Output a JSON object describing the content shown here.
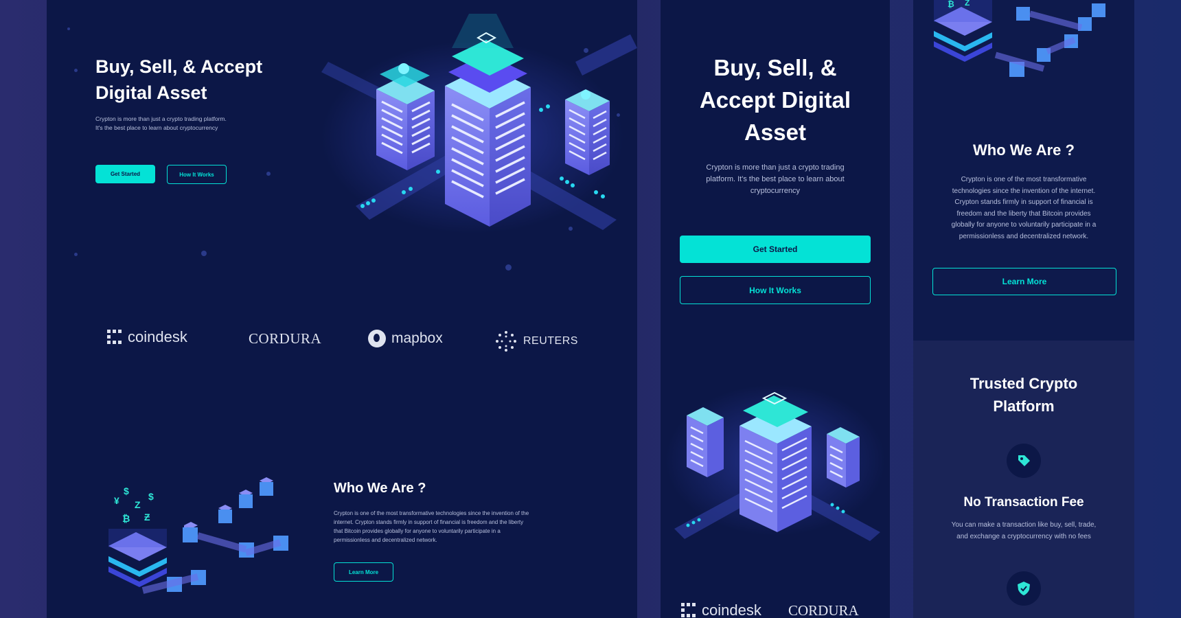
{
  "colors": {
    "background": "#0c1747",
    "accent": "#04e2d6",
    "text": "#ffffff",
    "muted": "#b8c0dd"
  },
  "desktop": {
    "hero": {
      "title_line1": "Buy, Sell, & Accept",
      "title_line2": "Digital Asset",
      "subtitle_line1": "Crypton is more than just a crypto trading platform.",
      "subtitle_line2": "It's the best place to learn about cryptocurrency",
      "primary_button": "Get Started",
      "secondary_button": "How It Works"
    },
    "logos": [
      "coindesk",
      "CORDURA",
      "mapbox",
      "REUTERS"
    ],
    "who": {
      "title": "Who We Are ?",
      "text_line1": "Crypton is one of the most transformative technologies since the invention of the",
      "text_line2": "internet. Crypton stands firmly in support of financial is freedom and the liberty",
      "text_line3": "that Bitcoin provides globally for anyone to voluntarily participate in a",
      "text_line4": "permissionless and decentralized network.",
      "button": "Learn More"
    }
  },
  "mobile1": {
    "title_line1": "Buy, Sell, &",
    "title_line2": "Accept Digital",
    "title_line3": "Asset",
    "text_line1": "Crypton is more than just a crypto trading",
    "text_line2": "platform. It's the best place to learn about",
    "text_line3": "cryptocurrency",
    "primary_button": "Get Started",
    "secondary_button": "How It Works",
    "logos": [
      "coindesk",
      "CORDURA"
    ]
  },
  "mobile2": {
    "who_title": "Who We Are ?",
    "who_line1": "Crypton is one of the most transformative",
    "who_line2": "technologies since the invention of the internet.",
    "who_line3": "Crypton stands firmly in support of financial is",
    "who_line4": "freedom and the liberty that Bitcoin provides",
    "who_line5": "globally for anyone to voluntarily participate in a",
    "who_line6": "permissionless and decentralized network.",
    "button": "Learn More",
    "trusted_line1": "Trusted Crypto",
    "trusted_line2": "Platform",
    "feature_title": "No Transaction Fee",
    "feature_line1": "You can make a transaction like buy, sell, trade,",
    "feature_line2": "and exchange a cryptocurrency with no fees"
  }
}
